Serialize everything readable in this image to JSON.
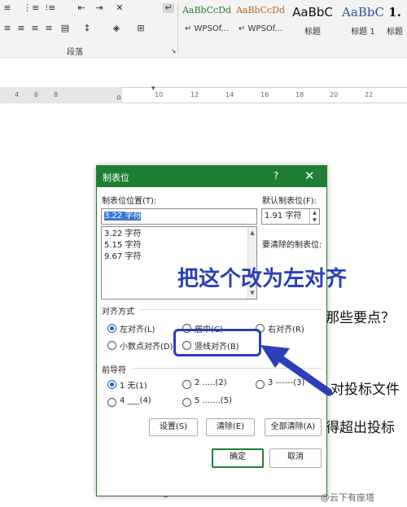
{
  "ribbon": {
    "paragraph_group_label": "段落",
    "styles": [
      {
        "sample": "AaBbCcDd",
        "name": "WPSOf...",
        "color": "#2a7a2a"
      },
      {
        "sample": "AaBbCcDd",
        "name": "WPSOf...",
        "color": "#b5651d"
      },
      {
        "sample": "AaBbC",
        "name": "标题",
        "color": "#111111"
      },
      {
        "sample": "AaBbC",
        "name": "标题 1",
        "color": "#2f5597"
      },
      {
        "sample": "1.",
        "name": "标题",
        "color": "#111111"
      }
    ]
  },
  "ruler": {
    "labels": [
      "4",
      "6",
      "8",
      "10",
      "12",
      "14",
      "16",
      "18",
      "20",
      "22"
    ]
  },
  "document": {
    "line1_tail": "那些要点？",
    "line2_tail": "对投标文件",
    "line3_tail": "得超出投标",
    "marks": [
      "↵",
      "↵",
      "↵"
    ]
  },
  "dialog": {
    "title": "制表位",
    "help": "?",
    "close": "✕",
    "tab_position_label": "制表位位置(T):",
    "tab_position_value": "3.22 字符",
    "tab_list": [
      "3.22 字符",
      "5.15 字符",
      "9.67 字符"
    ],
    "default_tab_label": "默认制表位(F):",
    "default_tab_value": "1.91 字符",
    "to_clear_label": "要清除的制表位:",
    "alignment_label": "对齐方式",
    "alignment_options": [
      {
        "label": "左对齐(L)",
        "checked": true
      },
      {
        "label": "居中(C)",
        "checked": false
      },
      {
        "label": "右对齐(R)",
        "checked": false
      },
      {
        "label": "小数点对齐(D)",
        "checked": false
      },
      {
        "label": "竖线对齐(B)",
        "checked": false
      }
    ],
    "leader_label": "前导符",
    "leader_options": [
      {
        "label": "1 无(1)",
        "checked": true
      },
      {
        "label": "2 .....(2)",
        "checked": false
      },
      {
        "label": "3 ------(3)",
        "checked": false
      },
      {
        "label": "4 ___(4)",
        "checked": false
      },
      {
        "label": "5 .......(5)",
        "checked": false
      }
    ],
    "set_button": "设置(S)",
    "clear_button": "清除(E)",
    "clear_all_button": "全部清除(A)",
    "ok_button": "确定",
    "cancel_button": "取消"
  },
  "annotation": {
    "callout": "把这个改为左对齐",
    "color": "#2a3fb8"
  },
  "watermark": "@云下有座塔"
}
